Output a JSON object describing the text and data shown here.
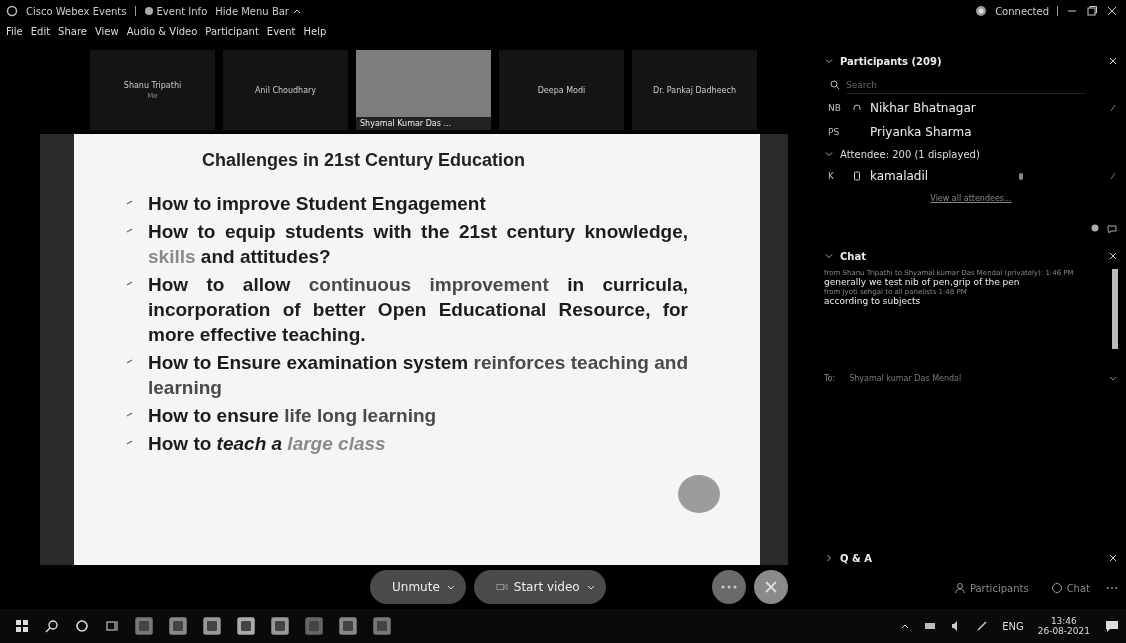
{
  "title_bar": {
    "app": "Cisco Webex Events",
    "event_info": "Event Info",
    "hide_menu": "Hide Menu Bar",
    "status": "Connected"
  },
  "menu": [
    "File",
    "Edit",
    "Share",
    "View",
    "Audio & Video",
    "Participant",
    "Event",
    "Help"
  ],
  "participant_strip": [
    {
      "kind": "name",
      "name": "Shanu Tripathi",
      "sub": "Me"
    },
    {
      "kind": "name",
      "name": "Anil Choudhary"
    },
    {
      "kind": "video",
      "name": "Shyamal Kumar Das ..."
    },
    {
      "kind": "name",
      "name": "Deepa Modi"
    },
    {
      "kind": "name",
      "name": "Dr. Pankaj Dadheech"
    }
  ],
  "slide": {
    "title": "Challenges in 21st Century Education",
    "bullets": [
      {
        "segments": [
          {
            "text": "How to improve Student Engagement",
            "color": "#1c1c1c",
            "italic": false
          }
        ]
      },
      {
        "segments": [
          {
            "text": "How to equip students with the 21st century knowledge, ",
            "color": "#1c1c1c",
            "italic": false
          },
          {
            "text": "skills",
            "color": "#8a8a8a",
            "italic": false
          },
          {
            "text": " and attitudes?",
            "color": "#1c1c1c",
            "italic": false
          }
        ]
      },
      {
        "segments": [
          {
            "text": "How to allow ",
            "color": "#1c1c1c",
            "italic": false
          },
          {
            "text": "continuous improvement",
            "color": "#4a4a4a",
            "italic": false
          },
          {
            "text": " in curricula, incorporation of better Open Educational Resource, for more effective teaching.",
            "color": "#1c1c1c",
            "italic": false
          }
        ]
      },
      {
        "segments": [
          {
            "text": "How to Ensure examination system ",
            "color": "#1c1c1c",
            "italic": false
          },
          {
            "text": "reinforces teaching and learning",
            "color": "#4a4a4a",
            "italic": false
          }
        ]
      },
      {
        "segments": [
          {
            "text": "How to ensure ",
            "color": "#1c1c1c",
            "italic": false
          },
          {
            "text": "life long learning",
            "color": "#4a4a4a",
            "italic": false
          }
        ]
      },
      {
        "segments": [
          {
            "text": "How to ",
            "color": "#1c1c1c",
            "italic": false
          },
          {
            "text": "teach a",
            "color": "#1c1c1c",
            "italic": true
          },
          {
            "text": " large class",
            "color": "#8a8a8a",
            "italic": true
          }
        ]
      }
    ]
  },
  "controls": {
    "unmute": "Unmute",
    "start_video": "Start video"
  },
  "panel": {
    "participants": {
      "title": "Participants (209)",
      "expanded": true,
      "search_placeholder": "Search",
      "people": [
        {
          "initials": "NB",
          "name": "Nikhar Bhatnagar",
          "kind": "host"
        },
        {
          "initials": "PS",
          "name": "Priyanka Sharma",
          "kind": "plain"
        }
      ],
      "attendee_group": {
        "title": "Attendee: 200 (1 displayed)",
        "expanded": true,
        "people": [
          {
            "initials": "K",
            "name": "kamaladil",
            "kind": "device"
          }
        ]
      },
      "view_all": "View all attendees..."
    },
    "chat": {
      "title": "Chat",
      "expanded": true,
      "messages": [
        {
          "meta": "from Shanu Tripathi to Shyamal kumar Das Mendal (privately):",
          "time": "1:46 PM",
          "text": "generally we test nib of pen,grip of the pen"
        },
        {
          "meta": "from Jyoti sehgal to all panelists",
          "time": "1:48 PM",
          "text": "according to subjects"
        }
      ],
      "to_label": "To:",
      "to_value": "Shyamal kumar Das Mendal"
    },
    "qa": {
      "title": "Q & A",
      "expanded": false
    },
    "buttons": [
      "Participants",
      "Chat"
    ]
  },
  "taskbar": {
    "language": "ENG",
    "time": "13:46",
    "date": "26-08-2021"
  }
}
